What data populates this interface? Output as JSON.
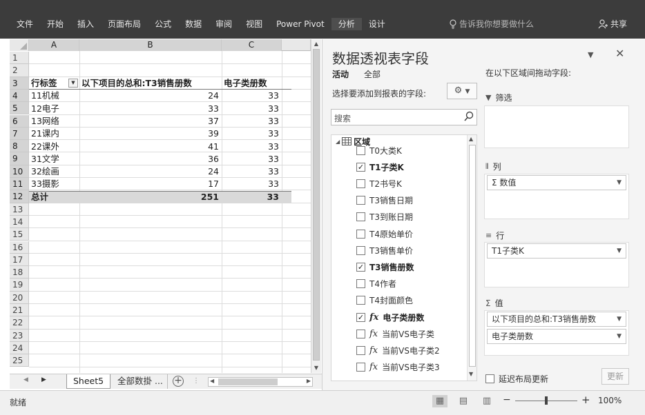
{
  "ribbon": {
    "tabs": [
      "文件",
      "开始",
      "插入",
      "页面布局",
      "公式",
      "数据",
      "审阅",
      "视图",
      "Power Pivot",
      "分析",
      "设计"
    ],
    "tell_me": "告诉我你想要做什么",
    "share": "共享"
  },
  "grid": {
    "columns": [
      "A",
      "B",
      "C"
    ],
    "row_numbers": [
      "1",
      "2",
      "3",
      "4",
      "5",
      "6",
      "7",
      "8",
      "9",
      "10",
      "11",
      "12",
      "13",
      "14",
      "15",
      "16",
      "17",
      "18",
      "19",
      "20",
      "21",
      "22",
      "23",
      "24",
      "25"
    ],
    "header": {
      "row_label": "行标签",
      "sum_label": "以下项目的总和:T3销售册数",
      "count_label": "电子类册数"
    },
    "rows": [
      {
        "label": "11机械",
        "sum": "24",
        "count": "33"
      },
      {
        "label": "12电子",
        "sum": "33",
        "count": "33"
      },
      {
        "label": "13网络",
        "sum": "37",
        "count": "33"
      },
      {
        "label": "21课内",
        "sum": "39",
        "count": "33"
      },
      {
        "label": "22课外",
        "sum": "41",
        "count": "33"
      },
      {
        "label": "31文学",
        "sum": "36",
        "count": "33"
      },
      {
        "label": "32绘画",
        "sum": "24",
        "count": "33"
      },
      {
        "label": "33摄影",
        "sum": "17",
        "count": "33"
      }
    ],
    "total": {
      "label": "总计",
      "sum": "251",
      "count": "33"
    }
  },
  "sheets": {
    "active": "Sheet5",
    "other": "全部数掛 ..."
  },
  "status": {
    "ready": "就绪",
    "zoom": "100%"
  },
  "pivot_panel": {
    "title": "数据透视表字段",
    "tab_active": "活动",
    "tab_all": "全部",
    "choose_label": "选择要添加到报表的字段:",
    "search_placeholder": "搜索",
    "group_name": "区域",
    "fields": [
      {
        "name": "T0大类K",
        "checked": false,
        "fx": false
      },
      {
        "name": "T1子类K",
        "checked": true,
        "fx": false
      },
      {
        "name": "T2书号K",
        "checked": false,
        "fx": false
      },
      {
        "name": "T3销售日期",
        "checked": false,
        "fx": false
      },
      {
        "name": "T3到账日期",
        "checked": false,
        "fx": false
      },
      {
        "name": "T4原始单价",
        "checked": false,
        "fx": false
      },
      {
        "name": "T3销售单价",
        "checked": false,
        "fx": false
      },
      {
        "name": "T3销售册数",
        "checked": true,
        "fx": false
      },
      {
        "name": "T4作者",
        "checked": false,
        "fx": false
      },
      {
        "name": "T4封面颜色",
        "checked": false,
        "fx": false
      },
      {
        "name": "电子类册数",
        "checked": true,
        "fx": true
      },
      {
        "name": "当前VS电子类",
        "checked": false,
        "fx": true
      },
      {
        "name": "当前VS电子类2",
        "checked": false,
        "fx": true
      },
      {
        "name": "当前VS电子类3",
        "checked": false,
        "fx": true
      }
    ],
    "drag_label": "在以下区域间拖动字段:",
    "areas": {
      "filter": {
        "label": "筛选"
      },
      "columns": {
        "label": "列",
        "items": [
          "Σ 数值"
        ]
      },
      "rows": {
        "label": "行",
        "items": [
          "T1子类K"
        ]
      },
      "values": {
        "label": "值",
        "items": [
          "以下项目的总和:T3销售册数",
          "电子类册数"
        ]
      }
    },
    "defer_label": "延迟布局更新",
    "update_label": "更新"
  }
}
